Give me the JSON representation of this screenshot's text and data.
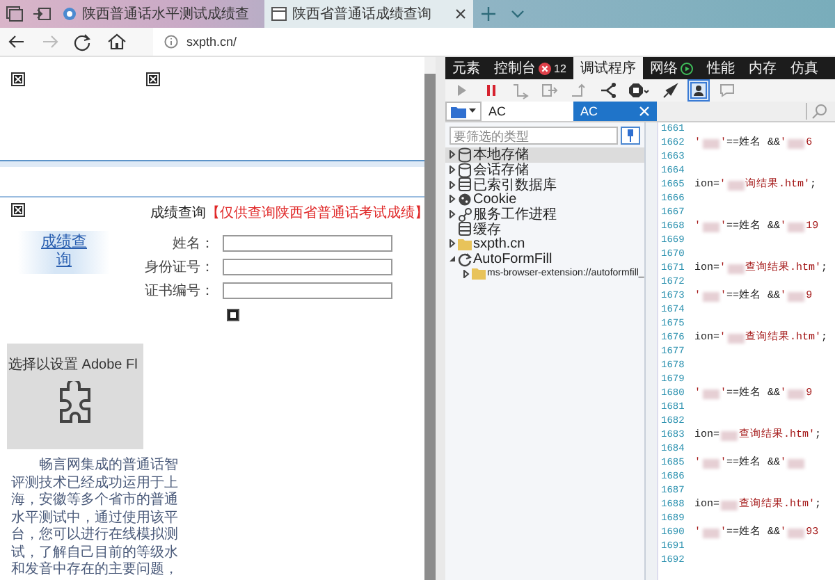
{
  "browser_tabs": [
    {
      "title": "陕西普通话水平测试成绩查",
      "selected": false
    },
    {
      "title": "陕西省普通话成绩查询",
      "selected": true
    }
  ],
  "address": {
    "url": "sxpth.cn/"
  },
  "page": {
    "heading": "成绩查询",
    "heading_note": "【仅供查询陕西省普通话考试成绩】",
    "side_link": "成绩查询",
    "form_fields": [
      {
        "label": "姓名："
      },
      {
        "label": "身份证号："
      },
      {
        "label": "证书编号："
      }
    ],
    "plugin_notice": "选择以设置 Adobe Fl",
    "intro_lines": [
      "畅言网集成的普通话智",
      "评测技术已经成功运用于上",
      "海，安徽等多个省市的普通",
      "水平测试中，通过使用该平",
      "台，您可以进行在线模拟测",
      "试，了解自己目前的等级水",
      "和发音中存在的主要问题，"
    ]
  },
  "devtools": {
    "tabs": [
      {
        "label": "元素",
        "selected": false,
        "recording": false
      },
      {
        "label": "控制台",
        "selected": false,
        "recording": false,
        "error_count": "12"
      },
      {
        "label": "调试程序",
        "selected": true,
        "recording": false
      },
      {
        "label": "网络",
        "selected": false,
        "recording": true
      },
      {
        "label": "性能",
        "selected": false,
        "recording": false
      },
      {
        "label": "内存",
        "selected": false,
        "recording": false
      },
      {
        "label": "仿真",
        "selected": false,
        "recording": false
      }
    ],
    "toolbar": [
      {
        "kind": "play",
        "disabled": true,
        "selected": false
      },
      {
        "kind": "pause",
        "disabled": false,
        "selected": false
      },
      {
        "kind": "step-over",
        "disabled": true,
        "selected": false
      },
      {
        "kind": "step-into",
        "disabled": true,
        "selected": false
      },
      {
        "kind": "step-out",
        "disabled": true,
        "selected": false
      },
      {
        "kind": "branch",
        "disabled": false,
        "selected": false
      },
      {
        "kind": "exceptions",
        "disabled": false,
        "selected": false
      },
      {
        "kind": "pin",
        "disabled": false,
        "selected": false
      },
      {
        "kind": "frame",
        "disabled": false,
        "selected": true
      },
      {
        "kind": "comment",
        "disabled": true,
        "selected": false
      }
    ],
    "file_tabs": [
      {
        "label": "AC",
        "selected": false
      },
      {
        "label": "AC",
        "selected": true
      }
    ],
    "filter": {
      "placeholder": "要筛选的类型"
    },
    "tree": [
      {
        "label": "本地存储",
        "kind": "storage",
        "expandable": true,
        "expanded": false,
        "selected": true
      },
      {
        "label": "会话存储",
        "kind": "storage",
        "expandable": true,
        "expanded": false,
        "selected": false
      },
      {
        "label": "已索引数据库",
        "kind": "database",
        "expandable": true,
        "expanded": false,
        "selected": false
      },
      {
        "label": "Cookie",
        "kind": "cookie",
        "expandable": true,
        "expanded": false,
        "selected": false
      },
      {
        "label": "服务工作进程",
        "kind": "worker",
        "expandable": true,
        "expanded": false,
        "selected": false
      },
      {
        "label": "缓存",
        "kind": "database",
        "expandable": false,
        "selected": false
      },
      {
        "label": "sxpth.cn",
        "kind": "folder",
        "expandable": true,
        "expanded": false,
        "selected": false
      },
      {
        "label": "AutoFormFill",
        "kind": "extension",
        "expandable": true,
        "expanded": true,
        "selected": false,
        "children": [
          {
            "label": "ms-browser-extension://autoformfill_",
            "kind": "folder",
            "expandable": true,
            "expanded": false,
            "selected": false
          }
        ]
      }
    ],
    "code_lines": [
      {
        "number": "1661"
      },
      {
        "number": "1662",
        "parts": [
          {
            "kind": "string",
            "text": "'"
          },
          {
            "kind": "redacted"
          },
          {
            "kind": "string",
            "text": "'"
          },
          {
            "kind": "plain",
            "text": "==姓名 && "
          },
          {
            "kind": "string",
            "text": "'"
          },
          {
            "kind": "redacted"
          },
          {
            "kind": "string",
            "text": "6"
          }
        ]
      },
      {
        "number": "1663"
      },
      {
        "number": "1664"
      },
      {
        "number": "1665",
        "parts": [
          {
            "kind": "plain",
            "text": "ion="
          },
          {
            "kind": "string",
            "text": "'"
          },
          {
            "kind": "redacted"
          },
          {
            "kind": "string",
            "text": "询结果.htm'"
          },
          {
            "kind": "plain",
            "text": ";"
          }
        ]
      },
      {
        "number": "1666"
      },
      {
        "number": "1667"
      },
      {
        "number": "1668",
        "parts": [
          {
            "kind": "string",
            "text": "'"
          },
          {
            "kind": "redacted"
          },
          {
            "kind": "string",
            "text": "'"
          },
          {
            "kind": "plain",
            "text": "==姓名 && "
          },
          {
            "kind": "string",
            "text": "'"
          },
          {
            "kind": "redacted"
          },
          {
            "kind": "string",
            "text": "19"
          }
        ]
      },
      {
        "number": "1669"
      },
      {
        "number": "1670"
      },
      {
        "number": "1671",
        "parts": [
          {
            "kind": "plain",
            "text": "ion="
          },
          {
            "kind": "string",
            "text": "'"
          },
          {
            "kind": "redacted"
          },
          {
            "kind": "string",
            "text": "查询结果.htm'"
          },
          {
            "kind": "plain",
            "text": ";"
          }
        ]
      },
      {
        "number": "1672"
      },
      {
        "number": "1673",
        "parts": [
          {
            "kind": "string",
            "text": "'"
          },
          {
            "kind": "redacted"
          },
          {
            "kind": "string",
            "text": "'"
          },
          {
            "kind": "plain",
            "text": "==姓名 && "
          },
          {
            "kind": "string",
            "text": "'"
          },
          {
            "kind": "redacted"
          },
          {
            "kind": "string",
            "text": "9"
          }
        ]
      },
      {
        "number": "1674"
      },
      {
        "number": "1675"
      },
      {
        "number": "1676",
        "parts": [
          {
            "kind": "plain",
            "text": "ion="
          },
          {
            "kind": "string",
            "text": "'"
          },
          {
            "kind": "redacted"
          },
          {
            "kind": "string",
            "text": "查询结果.htm'"
          },
          {
            "kind": "plain",
            "text": ";"
          }
        ]
      },
      {
        "number": "1677"
      },
      {
        "number": "1678"
      },
      {
        "number": "1679"
      },
      {
        "number": "1680",
        "parts": [
          {
            "kind": "string",
            "text": "'"
          },
          {
            "kind": "redacted"
          },
          {
            "kind": "string",
            "text": "'"
          },
          {
            "kind": "plain",
            "text": "==姓名 && "
          },
          {
            "kind": "string",
            "text": "'"
          },
          {
            "kind": "redacted"
          },
          {
            "kind": "string",
            "text": "9"
          }
        ]
      },
      {
        "number": "1681"
      },
      {
        "number": "1682"
      },
      {
        "number": "1683",
        "parts": [
          {
            "kind": "plain",
            "text": "ion="
          },
          {
            "kind": "redacted"
          },
          {
            "kind": "string",
            "text": "查询结果.htm'"
          },
          {
            "kind": "plain",
            "text": ";"
          }
        ]
      },
      {
        "number": "1684"
      },
      {
        "number": "1685",
        "parts": [
          {
            "kind": "string",
            "text": "'"
          },
          {
            "kind": "redacted"
          },
          {
            "kind": "string",
            "text": "'"
          },
          {
            "kind": "plain",
            "text": "==姓名 && "
          },
          {
            "kind": "string",
            "text": "'"
          },
          {
            "kind": "redacted"
          }
        ]
      },
      {
        "number": "1686"
      },
      {
        "number": "1687"
      },
      {
        "number": "1688",
        "parts": [
          {
            "kind": "plain",
            "text": "ion="
          },
          {
            "kind": "redacted"
          },
          {
            "kind": "string",
            "text": "查询结果.htm'"
          },
          {
            "kind": "plain",
            "text": ";"
          }
        ]
      },
      {
        "number": "1689"
      },
      {
        "number": "1690",
        "parts": [
          {
            "kind": "string",
            "text": "'"
          },
          {
            "kind": "redacted"
          },
          {
            "kind": "string",
            "text": "'"
          },
          {
            "kind": "plain",
            "text": "==姓名 && "
          },
          {
            "kind": "string",
            "text": "'"
          },
          {
            "kind": "redacted"
          },
          {
            "kind": "string",
            "text": "93"
          }
        ]
      },
      {
        "number": "1691"
      },
      {
        "number": "1692"
      }
    ]
  }
}
